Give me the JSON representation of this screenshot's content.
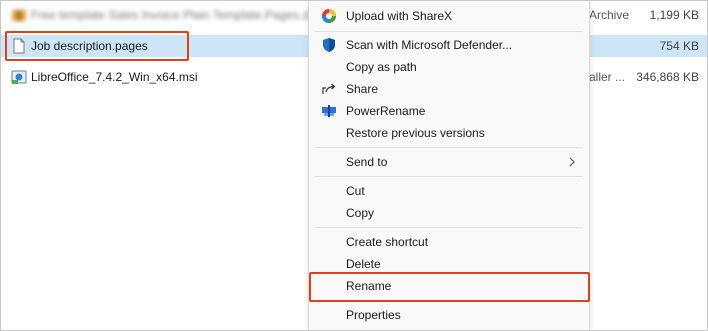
{
  "files": [
    {
      "name": "Free template Sales Invoice Plain Template.Pages.zip",
      "type": "Archive",
      "size": "1,199 KB",
      "icon": "archive-icon"
    },
    {
      "name": "Job description.pages",
      "type": "",
      "size": "754 KB",
      "icon": "document-icon"
    },
    {
      "name": "LibreOffice_7.4.2_Win_x64.msi",
      "type": "aller ...",
      "size": "346,868 KB",
      "icon": "installer-icon"
    }
  ],
  "menu": {
    "upload_sharex": "Upload with ShareX",
    "scan_defender": "Scan with Microsoft Defender...",
    "copy_as_path": "Copy as path",
    "share": "Share",
    "power_rename": "PowerRename",
    "restore_versions": "Restore previous versions",
    "send_to": "Send to",
    "cut": "Cut",
    "copy": "Copy",
    "create_shortcut": "Create shortcut",
    "delete": "Delete",
    "rename": "Rename",
    "properties": "Properties"
  },
  "colors": {
    "highlight": "#e0401c",
    "selection": "#cde6f7",
    "defender_blue": "#1a73c8",
    "sharex": "#e53935"
  }
}
